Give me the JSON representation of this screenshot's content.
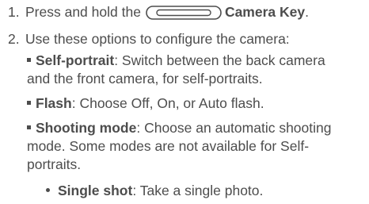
{
  "steps": [
    {
      "number": "1.",
      "text_before": "Press and hold the",
      "key_label": "Camera Key",
      "key_suffix": "."
    },
    {
      "number": "2.",
      "text": "Use these options to configure the camera:"
    }
  ],
  "options": [
    {
      "title": "Self-portrait",
      "lines": [
        ": Switch between the back camera",
        "and the front camera, for self-portraits."
      ]
    },
    {
      "title": "Flash",
      "lines": [
        ": Choose Off, On, or Auto flash."
      ]
    },
    {
      "title": "Shooting mode",
      "lines": [
        ": Choose an automatic shooting",
        "mode. Some modes are not available for Self-",
        "portraits."
      ]
    }
  ],
  "sub_options": [
    {
      "title": "Single shot",
      "text": ": Take a single photo."
    }
  ],
  "icons": {
    "camera_key": "camera-key-icon",
    "square_bullet": "square-bullet-icon",
    "round_bullet": "round-bullet-icon"
  }
}
